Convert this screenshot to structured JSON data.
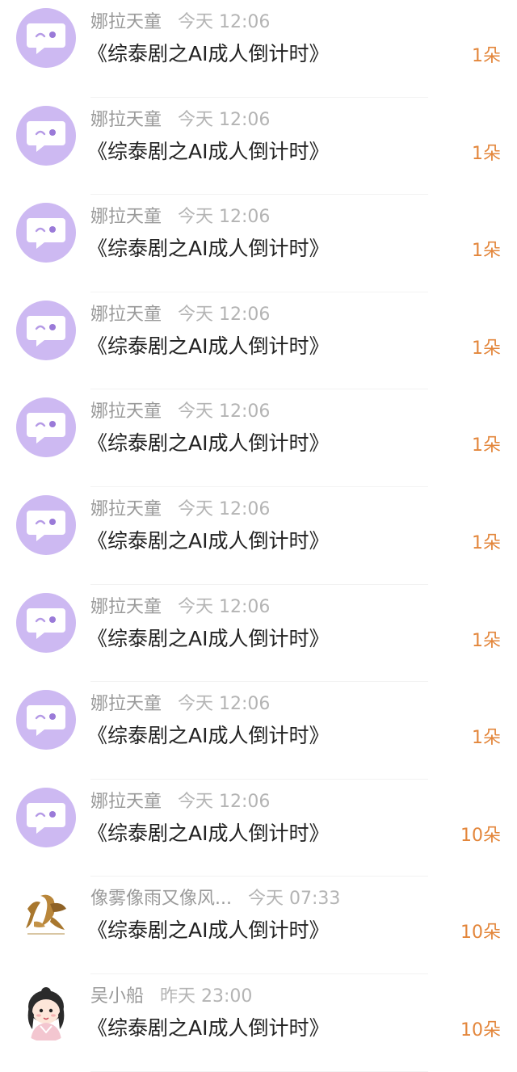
{
  "colors": {
    "avatar_purple": "#cdb9f2",
    "name_gray": "#9a9a9a",
    "time_gray": "#b4b4b4",
    "count_orange": "#e3863b"
  },
  "messages": [
    {
      "name": "娜拉天童",
      "time": "今天 12:06",
      "title": "《综泰剧之AI成人倒计时》",
      "count": "1朵",
      "avatar": "chat-bubble-icon"
    },
    {
      "name": "娜拉天童",
      "time": "今天 12:06",
      "title": "《综泰剧之AI成人倒计时》",
      "count": "1朵",
      "avatar": "chat-bubble-icon"
    },
    {
      "name": "娜拉天童",
      "time": "今天 12:06",
      "title": "《综泰剧之AI成人倒计时》",
      "count": "1朵",
      "avatar": "chat-bubble-icon"
    },
    {
      "name": "娜拉天童",
      "time": "今天 12:06",
      "title": "《综泰剧之AI成人倒计时》",
      "count": "1朵",
      "avatar": "chat-bubble-icon"
    },
    {
      "name": "娜拉天童",
      "time": "今天 12:06",
      "title": "《综泰剧之AI成人倒计时》",
      "count": "1朵",
      "avatar": "chat-bubble-icon"
    },
    {
      "name": "娜拉天童",
      "time": "今天 12:06",
      "title": "《综泰剧之AI成人倒计时》",
      "count": "1朵",
      "avatar": "chat-bubble-icon"
    },
    {
      "name": "娜拉天童",
      "time": "今天 12:06",
      "title": "《综泰剧之AI成人倒计时》",
      "count": "1朵",
      "avatar": "chat-bubble-icon"
    },
    {
      "name": "娜拉天童",
      "time": "今天 12:06",
      "title": "《综泰剧之AI成人倒计时》",
      "count": "1朵",
      "avatar": "chat-bubble-icon"
    },
    {
      "name": "娜拉天童",
      "time": "今天 12:06",
      "title": "《综泰剧之AI成人倒计时》",
      "count": "10朵",
      "avatar": "chat-bubble-icon"
    },
    {
      "name": "像雾像雨又像风...",
      "time": "今天 07:33",
      "title": "《综泰剧之AI成人倒计时》",
      "count": "10朵",
      "avatar": "calligraphy-avatar"
    },
    {
      "name": "吴小船",
      "time": "昨天 23:00",
      "title": "《综泰剧之AI成人倒计时》",
      "count": "10朵",
      "avatar": "cartoon-girl-avatar"
    }
  ]
}
